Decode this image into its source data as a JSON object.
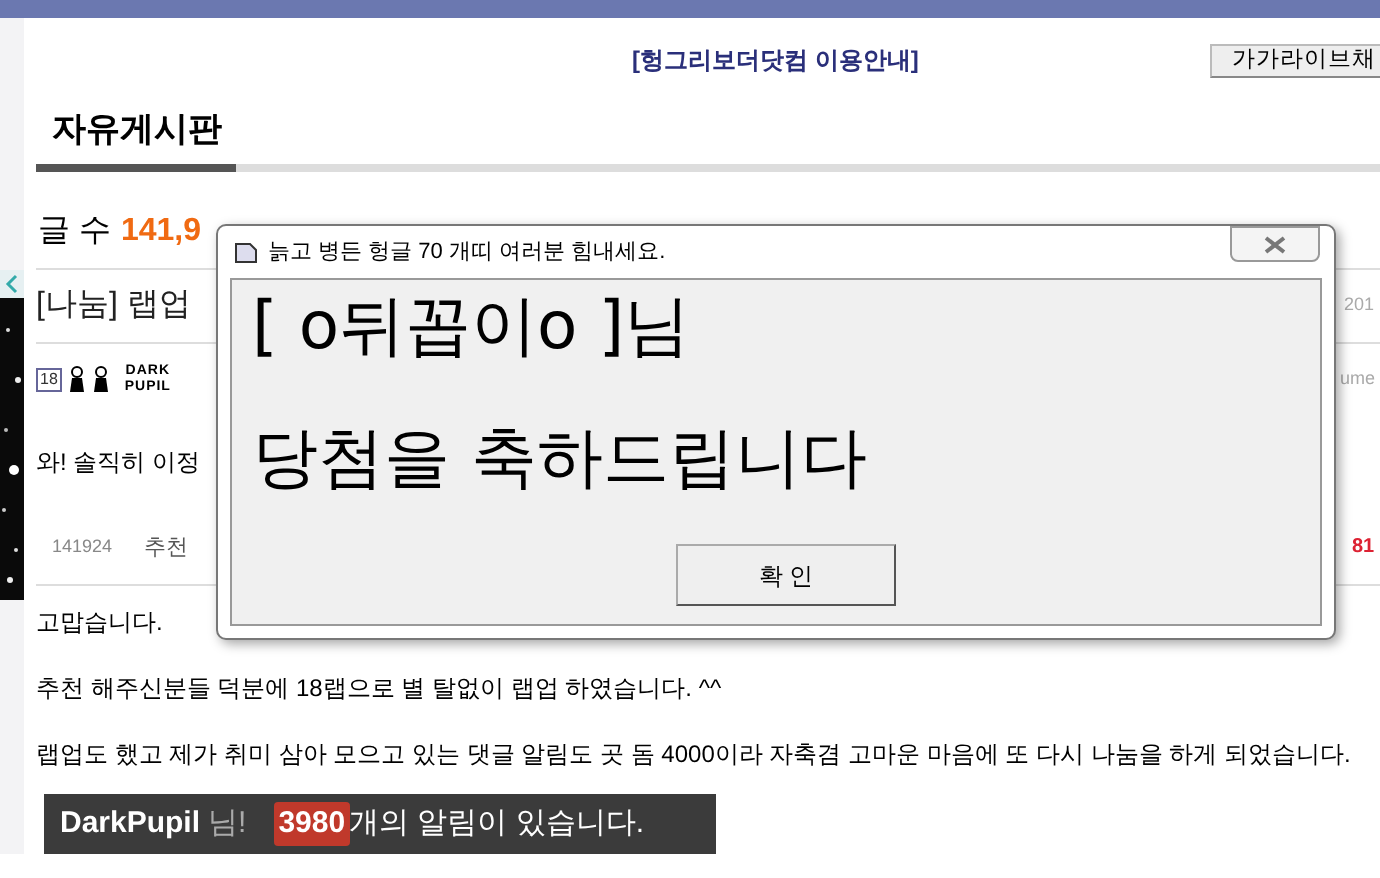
{
  "top_link": "[헝그리보더닷컴 이용안내]",
  "side_button": "가가라이브채",
  "board_title": "자유게시판",
  "post_count": {
    "label": "글 수",
    "value": "141,9"
  },
  "post": {
    "title": "[나눔] 랩업",
    "date": "201",
    "level_badge": "18",
    "author_logo": "DARK PUPIL",
    "column_cut": "ume",
    "excerpt": "와! 솔직히 이정",
    "number": "141924",
    "recommend": "추천",
    "count": "81",
    "paragraphs": [
      "고맙습니다.",
      "추천 해주신분들 덕분에 18랩으로 별 탈없이  랩업 하였습니다. ^^",
      "랩업도 했고 제가 취미 삼아 모으고 있는 댓글 알림도 곳 돔 4000이라 자축겸 고마운 마음에 또 다시 나눔을 하게 되었습니다."
    ]
  },
  "notice": {
    "user": "DarkPupil",
    "suffix": "님!",
    "count": "3980",
    "message": "개의 알림이 있습니다."
  },
  "dialog": {
    "title": "늙고 병든 헝글 70 개띠 여러분 힘내세요.",
    "lines": [
      "[ o뒤꼽이o ]님",
      "당첨을 축하드립니다"
    ],
    "button": "확 인"
  }
}
